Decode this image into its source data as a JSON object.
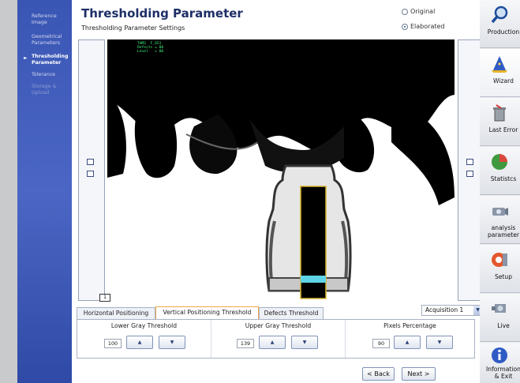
{
  "sidebar": {
    "items": [
      {
        "label": "Reference\nImage"
      },
      {
        "label": "Geometrical\nParameters"
      },
      {
        "label": "Thresholding\nParameter"
      },
      {
        "label": "Tolerance"
      },
      {
        "label": "Storage &\nUpload"
      }
    ]
  },
  "header": {
    "title": "Thresholding Parameter",
    "subtitle": "Thresholding Parameter Settings",
    "radio_original": "Original",
    "radio_elaborated": "Elaborated"
  },
  "viewer": {
    "overlay_lines": "THM2  F_651\nDefects = 00\nLevel   = 00",
    "frame_number": "1"
  },
  "tabs": [
    {
      "label": "Horizontal Positioning"
    },
    {
      "label": "Vertical Positioning Threshold"
    },
    {
      "label": "Defects Threshold"
    }
  ],
  "acquisition": {
    "selected": "Acquisition 1"
  },
  "thresholds": [
    {
      "title": "Lower Gray Threshold",
      "value": "100"
    },
    {
      "title": "Upper Gray Threshold",
      "value": "139"
    },
    {
      "title": "Pixels Percentage",
      "value": "90"
    }
  ],
  "footer": {
    "back": "< Back",
    "next": "Next >"
  },
  "toolbar": [
    {
      "label": "Production",
      "icon": "magnifier-icon"
    },
    {
      "label": "Wizard",
      "icon": "wizard-hat-icon"
    },
    {
      "label": "Last Error",
      "icon": "trash-icon"
    },
    {
      "label": "Statistcs",
      "icon": "pie-chart-icon"
    },
    {
      "label": "analysis\nparameter",
      "icon": "camera-icon"
    },
    {
      "label": "Setup",
      "icon": "setup-icon"
    },
    {
      "label": "Live",
      "icon": "live-camera-icon"
    },
    {
      "label": "Information\n& Exit",
      "icon": "info-icon"
    }
  ],
  "colors": {
    "accent": "#1d2f66",
    "sidebar": "#3a56b4",
    "measure": "#5fd4e6"
  }
}
